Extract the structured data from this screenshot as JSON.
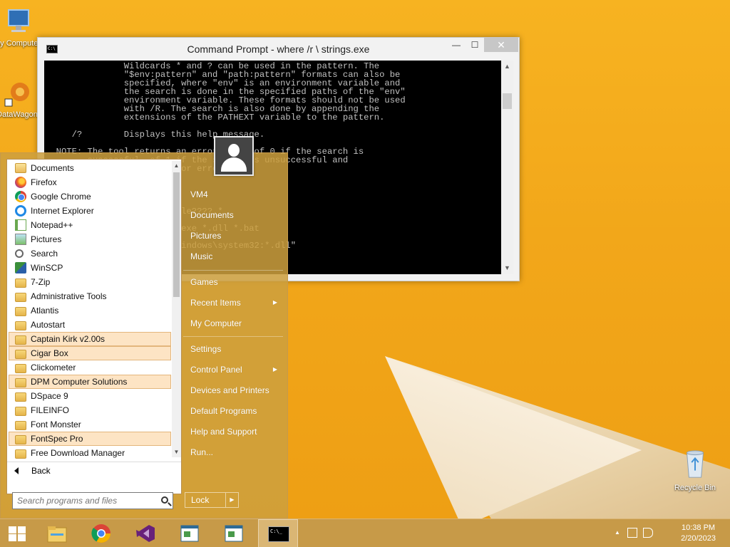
{
  "desktop": {
    "icons": [
      {
        "label": "My Computer"
      },
      {
        "label": "DataWagon"
      },
      {
        "label": "Recycle Bin"
      }
    ]
  },
  "cmd": {
    "title": "Command Prompt - where  /r \\ strings.exe",
    "close_glyph": "✕",
    "min_glyph": "—",
    "max_glyph": "☐",
    "icon_text": "C:\\",
    "text": "               Wildcards * and ? can be used in the pattern. The\n               \"$env:pattern\" and \"path:pattern\" formats can also be\n               specified, where \"env\" is an environment variable and\n               the search is done in the specified paths of the \"env\"\n               environment variable. These formats should not be used\n               with /R. The search is also done by appending the\n               extensions of the PATHEXT variable to the pattern.\n\n     /?        Displays this help message.\n\n  NOTE: The tool returns an error level of 0 if the search is\n        successful, of 1 if the search is unsuccessful and\n        of 2 for failures or errors.\n\nExamples:\n\n    WHERE /?\n    WHERE myfilename1 myfile????.*\n    WHERE $windir:*.exe\n    WHERE /R c:\\windows *.exe *.dll *.bat\n    WHERE /Q ??.???\n    WHERE \"c:\\windows;c:\\windows\\system32:*.dll\"\n    WHERE /F /T *.dll\n\nC:\\>where /r \\ strings.exe"
  },
  "start_menu": {
    "programs": [
      {
        "label": "Documents",
        "icon": "documents-icon",
        "hl": false
      },
      {
        "label": "Firefox",
        "icon": "firefox-icon",
        "hl": false
      },
      {
        "label": "Google Chrome",
        "icon": "chrome-icon",
        "hl": false
      },
      {
        "label": "Internet Explorer",
        "icon": "ie-icon",
        "hl": false
      },
      {
        "label": "Notepad++",
        "icon": "notepad-icon",
        "hl": false
      },
      {
        "label": "Pictures",
        "icon": "pictures-icon",
        "hl": false
      },
      {
        "label": "Search",
        "icon": "search-icon",
        "hl": false
      },
      {
        "label": "WinSCP",
        "icon": "winscp-icon",
        "hl": false
      },
      {
        "label": "7-Zip",
        "icon": "folder-icon",
        "hl": false
      },
      {
        "label": "Administrative Tools",
        "icon": "folder-icon",
        "hl": false
      },
      {
        "label": "Atlantis",
        "icon": "folder-icon",
        "hl": false
      },
      {
        "label": "Autostart",
        "icon": "folder-icon",
        "hl": false
      },
      {
        "label": "Captain Kirk v2.00s",
        "icon": "folder-icon",
        "hl": true
      },
      {
        "label": "Cigar Box",
        "icon": "folder-icon",
        "hl": true
      },
      {
        "label": "Clickometer",
        "icon": "folder-icon",
        "hl": false
      },
      {
        "label": "DPM Computer Solutions",
        "icon": "folder-icon",
        "hl": true
      },
      {
        "label": "DSpace 9",
        "icon": "folder-icon",
        "hl": false
      },
      {
        "label": "FILEINFO",
        "icon": "folder-icon",
        "hl": false
      },
      {
        "label": "Font Monster",
        "icon": "folder-icon",
        "hl": false
      },
      {
        "label": "FontSpec Pro",
        "icon": "folder-icon",
        "hl": true
      },
      {
        "label": "Free Download Manager",
        "icon": "folder-icon",
        "hl": false
      }
    ],
    "back_label": "Back",
    "search_placeholder": "Search programs and files",
    "right_items": {
      "user": "VM4",
      "documents": "Documents",
      "pictures": "Pictures",
      "music": "Music",
      "games": "Games",
      "recent": "Recent Items",
      "computer": "My Computer",
      "settings": "Settings",
      "control_panel": "Control Panel",
      "devices": "Devices and Printers",
      "defaults": "Default Programs",
      "help": "Help and Support",
      "run": "Run..."
    },
    "lock_label": "Lock",
    "submenu_glyph": "▶",
    "scroll_up": "▲",
    "scroll_down": "▼"
  },
  "taskbar": {
    "time": "10:38 PM",
    "date": "2/20/2023",
    "tray_up": "▲",
    "active_app_text": "C:\\_"
  },
  "colors": {
    "wallpaper": "#f2a81c",
    "start_menu": "#cda03e",
    "highlight": "#fde4c4"
  }
}
